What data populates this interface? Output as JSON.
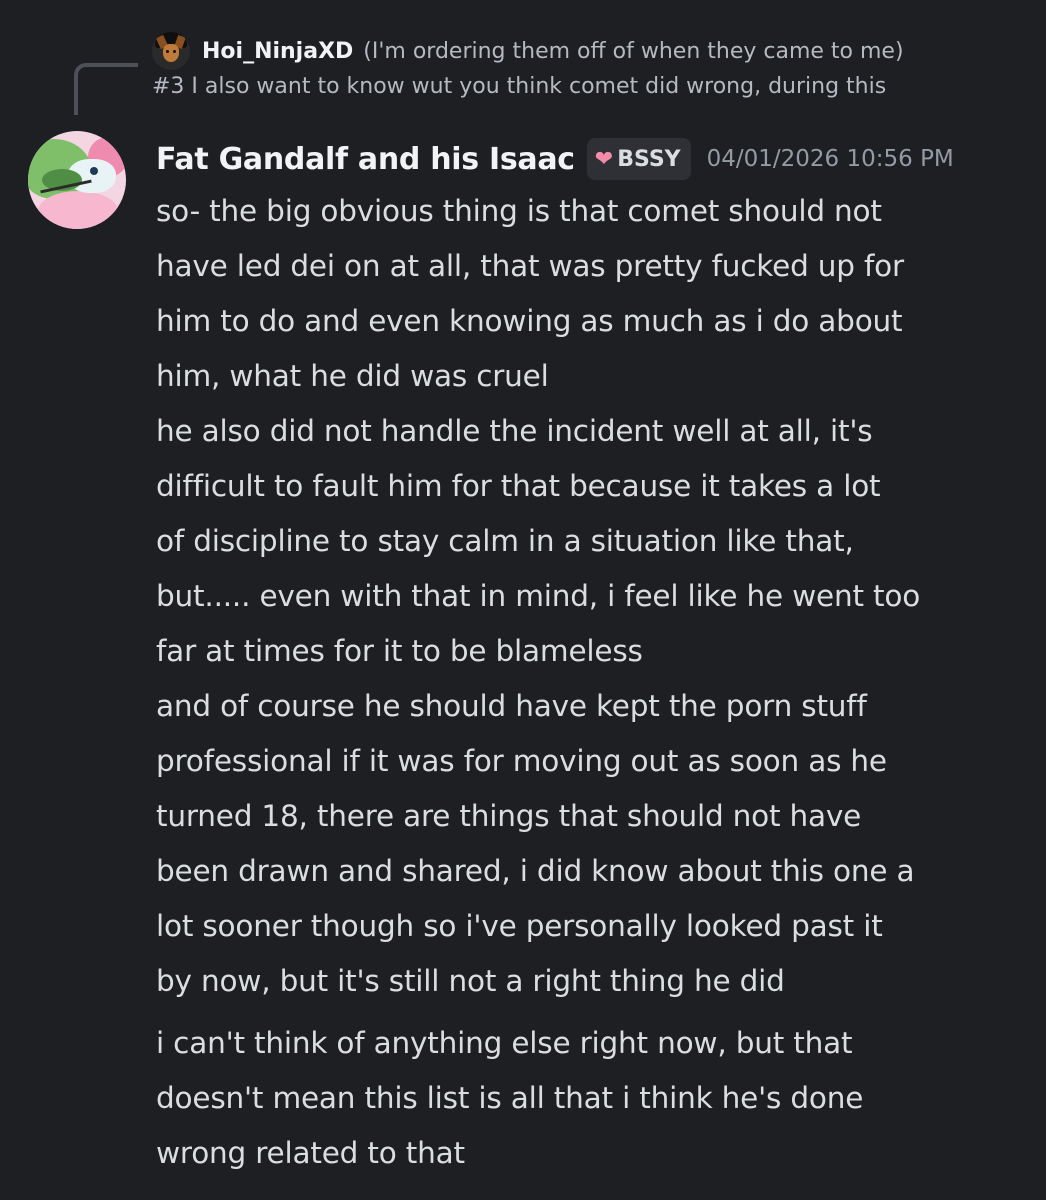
{
  "reply": {
    "author": "Hoi_NinjaXD",
    "preview_line1": "(I'm ordering them off of when they came to me)",
    "preview_line2": "#3 I also want to know wut you think comet did wrong, during this",
    "avatar_icon": "doberman-avatar"
  },
  "message": {
    "username": "Fat Gandalf and his Isaac",
    "tag": {
      "icon": "heart-icon",
      "icon_color": "#f48ca9",
      "label": "BSSY"
    },
    "timestamp": "04/01/2026 10:56 PM",
    "lines": [
      "so- the big obvious thing is that comet should not",
      "have led dei on at all, that was pretty fucked up for",
      "him to do and even knowing as much as i do about",
      "him, what he did was cruel",
      "he also did not handle the incident well at all, it's",
      "difficult to fault him for that because it takes a lot",
      "of discipline to stay calm in a situation like that,",
      "but..... even with that in mind, i feel like he went too",
      "far at times for it to be blameless",
      "and of course he should have kept the porn stuff",
      "professional if it was for moving out as soon as he",
      "turned 18, there are things that should not have",
      "been drawn and shared, i did know about this one a",
      "lot sooner though so i've personally looked past it",
      "by now, but it's still not a right thing he did"
    ],
    "followup_lines": [
      "i can't think of anything else right now, but that",
      "doesn't mean this list is all that i think he's done",
      "wrong related to that"
    ]
  },
  "colors": {
    "background": "#1e1f23",
    "text": "#dbdee1",
    "muted": "#949ba4",
    "username": "#f2f3f5"
  }
}
